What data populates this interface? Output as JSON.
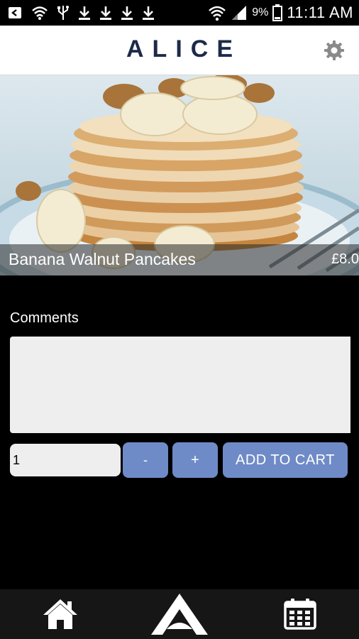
{
  "status_bar": {
    "battery_percent": "9%",
    "time": "11:11 AM",
    "icons": [
      "back-arrow-icon",
      "wifi-icon",
      "usb-icon",
      "download-icon",
      "download-icon",
      "download-icon",
      "download-icon",
      "wifi-icon",
      "signal-icon",
      "battery-icon"
    ]
  },
  "header": {
    "logo": "ALICE",
    "settings_icon": "gear-icon"
  },
  "hero": {
    "title": "Banana Walnut Pancakes",
    "price": "£8.0"
  },
  "form": {
    "comments_label": "Comments",
    "comments_value": "",
    "quantity_value": "1",
    "minus_label": "-",
    "plus_label": "+",
    "add_to_cart_label": "ADD TO CART"
  },
  "bottom_nav": {
    "items": [
      "home-icon",
      "alice-logo-icon",
      "calendar-icon"
    ]
  },
  "colors": {
    "accent": "#6f8bc7",
    "logo": "#1d2a4a",
    "background": "#000000",
    "nav_background": "#161616"
  }
}
